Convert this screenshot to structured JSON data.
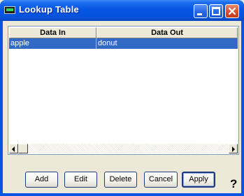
{
  "window": {
    "title": "Lookup Table"
  },
  "table": {
    "columns": [
      "Data In",
      "Data Out"
    ],
    "rows": [
      {
        "data_in": "apple",
        "data_out": "donut",
        "selected": true
      }
    ]
  },
  "buttons": {
    "add": "Add",
    "edit": "Edit",
    "delete": "Delete",
    "cancel": "Cancel",
    "apply": "Apply"
  },
  "help": {
    "label": "?"
  },
  "colors": {
    "title_bar": "#0a54e4",
    "selection": "#316ac5",
    "face": "#ece9d8"
  }
}
